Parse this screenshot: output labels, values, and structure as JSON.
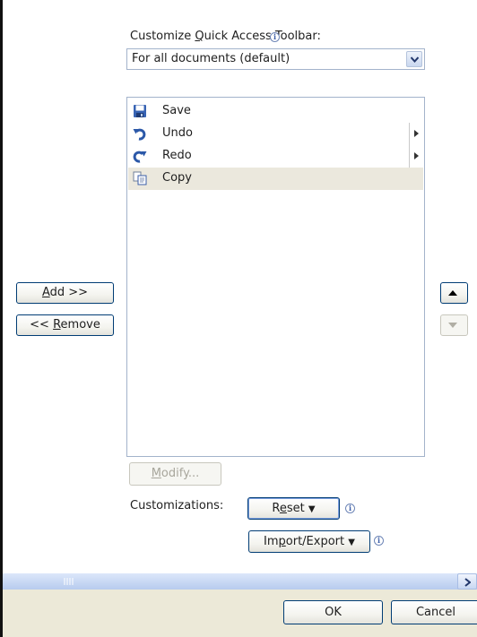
{
  "toolbar_label": {
    "prefix": "Customize ",
    "mnemonic": "Q",
    "suffix": "uick Access Toolbar:",
    "info": "i"
  },
  "scope_select": {
    "value": "For all documents (default)"
  },
  "commands": [
    {
      "label": "Save",
      "icon": "save-icon",
      "has_submenu": false,
      "selected": false
    },
    {
      "label": "Undo",
      "icon": "undo-icon",
      "has_submenu": true,
      "selected": false
    },
    {
      "label": "Redo",
      "icon": "redo-icon",
      "has_submenu": true,
      "selected": false
    },
    {
      "label": "Copy",
      "icon": "copy-icon",
      "has_submenu": false,
      "selected": true
    }
  ],
  "add_button": {
    "mnemonic": "A",
    "rest": "dd >>"
  },
  "remove_button": {
    "before": "<< ",
    "mnemonic": "R",
    "rest": "emove"
  },
  "modify_button": {
    "mnemonic": "M",
    "rest": "odify..."
  },
  "customizations": {
    "label": "Customizations:",
    "reset": {
      "before": "R",
      "mnemonic": "e",
      "rest": "set",
      "arrow": "▼"
    },
    "import_export": {
      "before": "Im",
      "mnemonic": "p",
      "rest": "ort/Export",
      "arrow": "▼"
    }
  },
  "dialog": {
    "ok": "OK",
    "cancel": "Cancel"
  },
  "colors": {
    "accent_border": "#003c74",
    "selection": "#ebe8dd",
    "footer": "#ece9d8",
    "scrollbar": "#c8d7f2"
  }
}
